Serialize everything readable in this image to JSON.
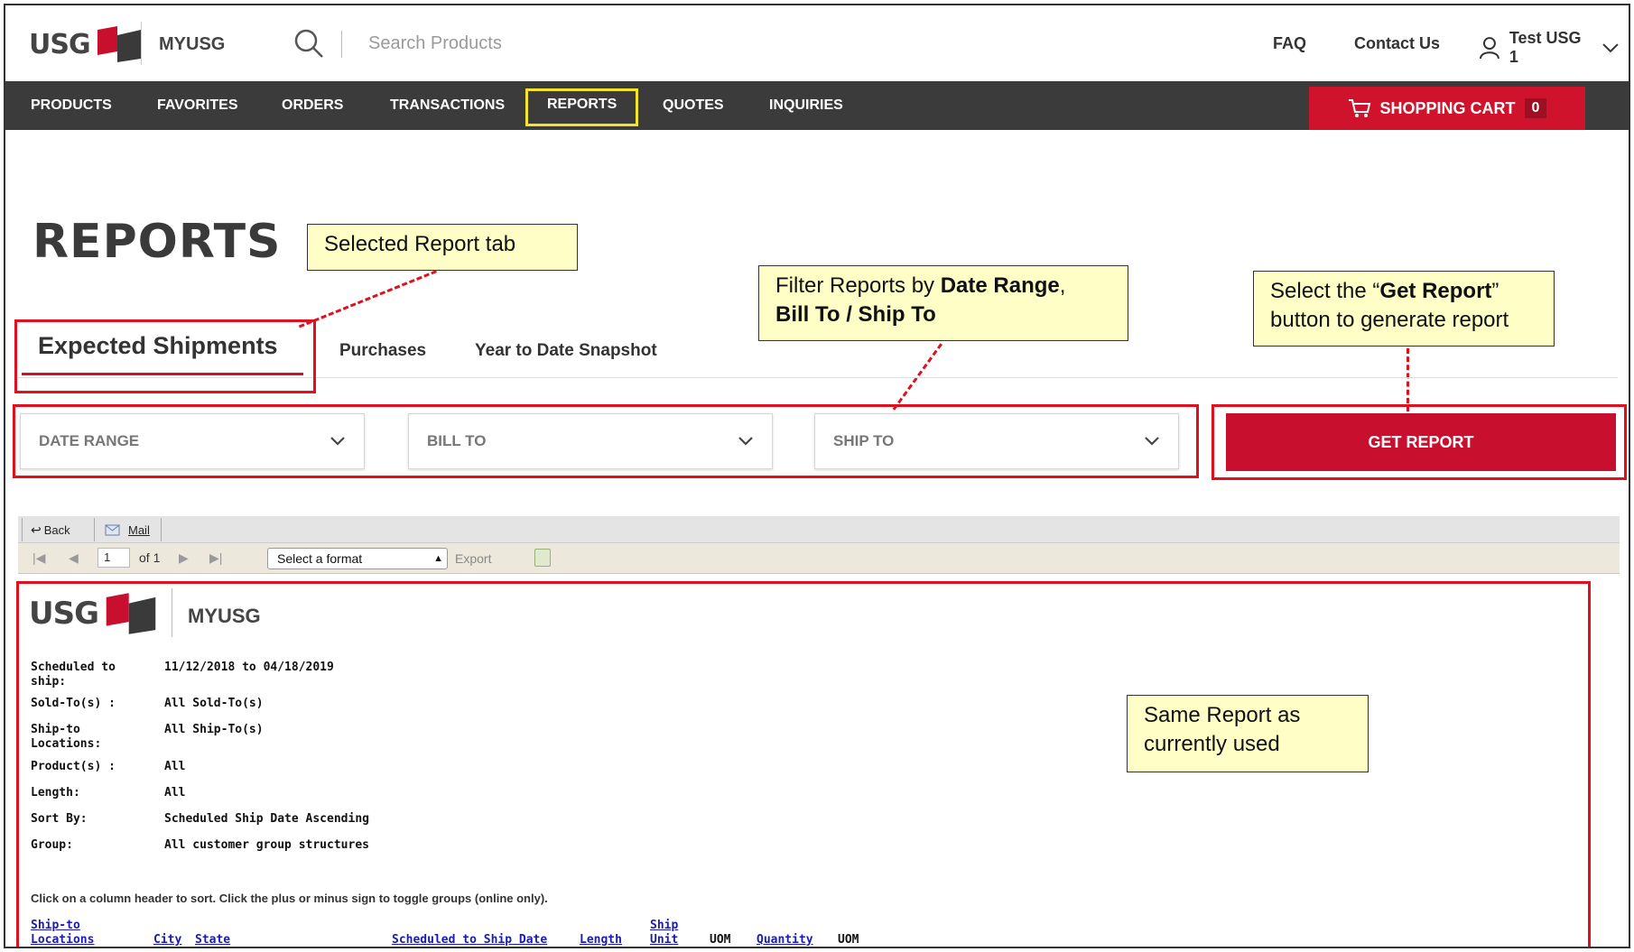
{
  "header": {
    "logo_text": "USG",
    "logo_sub": "MYUSG",
    "search_placeholder": "Search Products",
    "faq": "FAQ",
    "contact": "Contact Us",
    "user": "Test USG 1"
  },
  "nav": {
    "items": [
      "PRODUCTS",
      "FAVORITES",
      "ORDERS",
      "TRANSACTIONS",
      "REPORTS",
      "QUOTES",
      "INQUIRIES"
    ],
    "cart_label": "SHOPPING CART",
    "cart_count": "0"
  },
  "page_title": "REPORTS",
  "tabs": [
    "Expected Shipments",
    "Purchases",
    "Year to Date Snapshot"
  ],
  "filters": {
    "date_range": "DATE RANGE",
    "bill_to": "BILL TO",
    "ship_to": "SHIP TO",
    "get_report": "GET REPORT"
  },
  "callouts": {
    "tab": "Selected Report tab",
    "filter_prefix": "Filter Reports by ",
    "filter_bold1": "Date Range",
    "filter_comma": ",",
    "filter_bold2": "Bill To / Ship To",
    "report_pre": "Select the “",
    "report_bold": "Get Report",
    "report_post": "” button to generate report",
    "same_report": "Same Report as currently used"
  },
  "viewer": {
    "back": "Back",
    "mail": "Mail",
    "page": "1",
    "of": "of 1",
    "format": "Select a format",
    "export": "Export",
    "logo_text": "USG",
    "logo_sub": "MYUSG",
    "fields": [
      {
        "label": "Scheduled to ship:",
        "value": "11/12/2018 to 04/18/2019"
      },
      {
        "label": "Sold-To(s) :",
        "value": "All Sold-To(s)"
      },
      {
        "label": "Ship-to Locations:",
        "value": "All Ship-To(s)"
      },
      {
        "label": "Product(s) :",
        "value": "All"
      },
      {
        "label": "Length:",
        "value": "All"
      },
      {
        "label": "Sort By:",
        "value": "Scheduled Ship Date Ascending"
      },
      {
        "label": "Group:",
        "value": "All customer group structures"
      }
    ],
    "note": "Click on a column header to sort.  Click the plus or minus sign to toggle groups (online only).",
    "columns": {
      "shipto_1": "Ship-to",
      "shipto_2": "Locations",
      "city": "City",
      "state": "State",
      "sched": "Scheduled to Ship Date",
      "length": "Length",
      "ship_1": "Ship",
      "ship_2": "Unit",
      "uom1": "UOM",
      "quantity": "Quantity",
      "uom2": "UOM"
    }
  },
  "colors": {
    "brand_red": "#c8102e",
    "nav_bg": "#3b3b3b",
    "highlight": "#f5e52a",
    "callout_bg": "#fffec7",
    "annotation_red": "#e0101e"
  }
}
